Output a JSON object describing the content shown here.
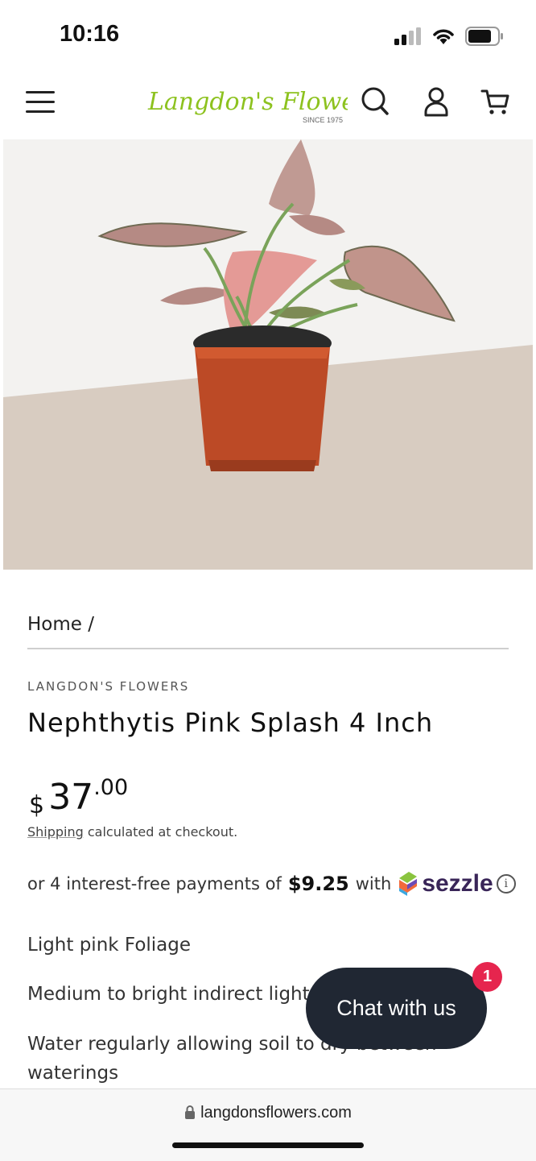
{
  "status_bar": {
    "time": "10:16"
  },
  "header": {
    "logo_text": "Langdon's Flowers",
    "logo_tagline": "SINCE 1975",
    "logo_color": "#8dc21f"
  },
  "product": {
    "breadcrumb": "Home /",
    "vendor": "LANGDON'S FLOWERS",
    "title": "Nephthytis Pink Splash 4 Inch",
    "price_currency": "$",
    "price_whole": "37",
    "price_cents": ".00",
    "shipping_link": "Shipping",
    "shipping_rest": " calculated at checkout.",
    "sezzle_prefix": "or 4 interest-free payments of",
    "sezzle_amount": "$9.25",
    "sezzle_with": "with",
    "sezzle_brand": "sezzle",
    "features": [
      "Light pink Foliage",
      "Medium to bright indirect light",
      "Water regularly allowing soil to dry between",
      "waterings"
    ]
  },
  "chat": {
    "label": "Chat with us",
    "badge": "1"
  },
  "browser": {
    "url": "langdonsflowers.com"
  }
}
